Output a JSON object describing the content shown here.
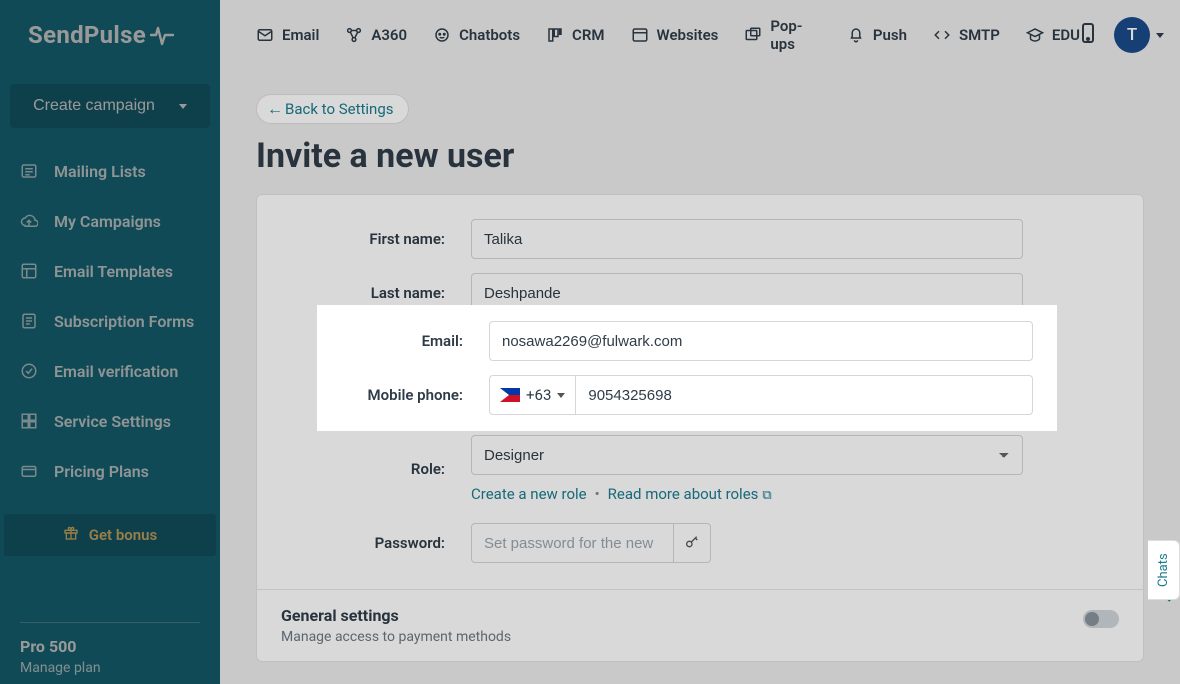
{
  "brand": "SendPulse",
  "create_campaign": "Create campaign",
  "sidebar": {
    "items": [
      {
        "label": "Mailing Lists"
      },
      {
        "label": "My Campaigns"
      },
      {
        "label": "Email Templates"
      },
      {
        "label": "Subscription Forms"
      },
      {
        "label": "Email verification"
      },
      {
        "label": "Service Settings"
      },
      {
        "label": "Pricing Plans"
      }
    ],
    "bonus": "Get bonus",
    "plan_name": "Pro 500",
    "manage_plan": "Manage plan"
  },
  "topnav": {
    "items": [
      {
        "label": "Email"
      },
      {
        "label": "A360"
      },
      {
        "label": "Chatbots"
      },
      {
        "label": "CRM"
      },
      {
        "label": "Websites"
      },
      {
        "label": "Pop-ups"
      },
      {
        "label": "Push"
      },
      {
        "label": "SMTP"
      },
      {
        "label": "EDU"
      }
    ],
    "avatar_letter": "T"
  },
  "page": {
    "back": "Back to Settings",
    "title": "Invite a new user",
    "labels": {
      "first_name": "First name:",
      "last_name": "Last name:",
      "email": "Email:",
      "mobile": "Mobile phone:",
      "role": "Role:",
      "password": "Password:"
    },
    "values": {
      "first_name": "Talika",
      "last_name": "Deshpande",
      "email": "nosawa2269@fulwark.com",
      "phone_code": "+63",
      "phone": "9054325698",
      "role": "Designer"
    },
    "role_links": {
      "create": "Create a new role",
      "read_more": "Read more about roles"
    },
    "password_placeholder": "Set password for the new",
    "general": {
      "title": "General settings",
      "sub": "Manage access to payment methods"
    }
  },
  "chats_tab": "Chats"
}
